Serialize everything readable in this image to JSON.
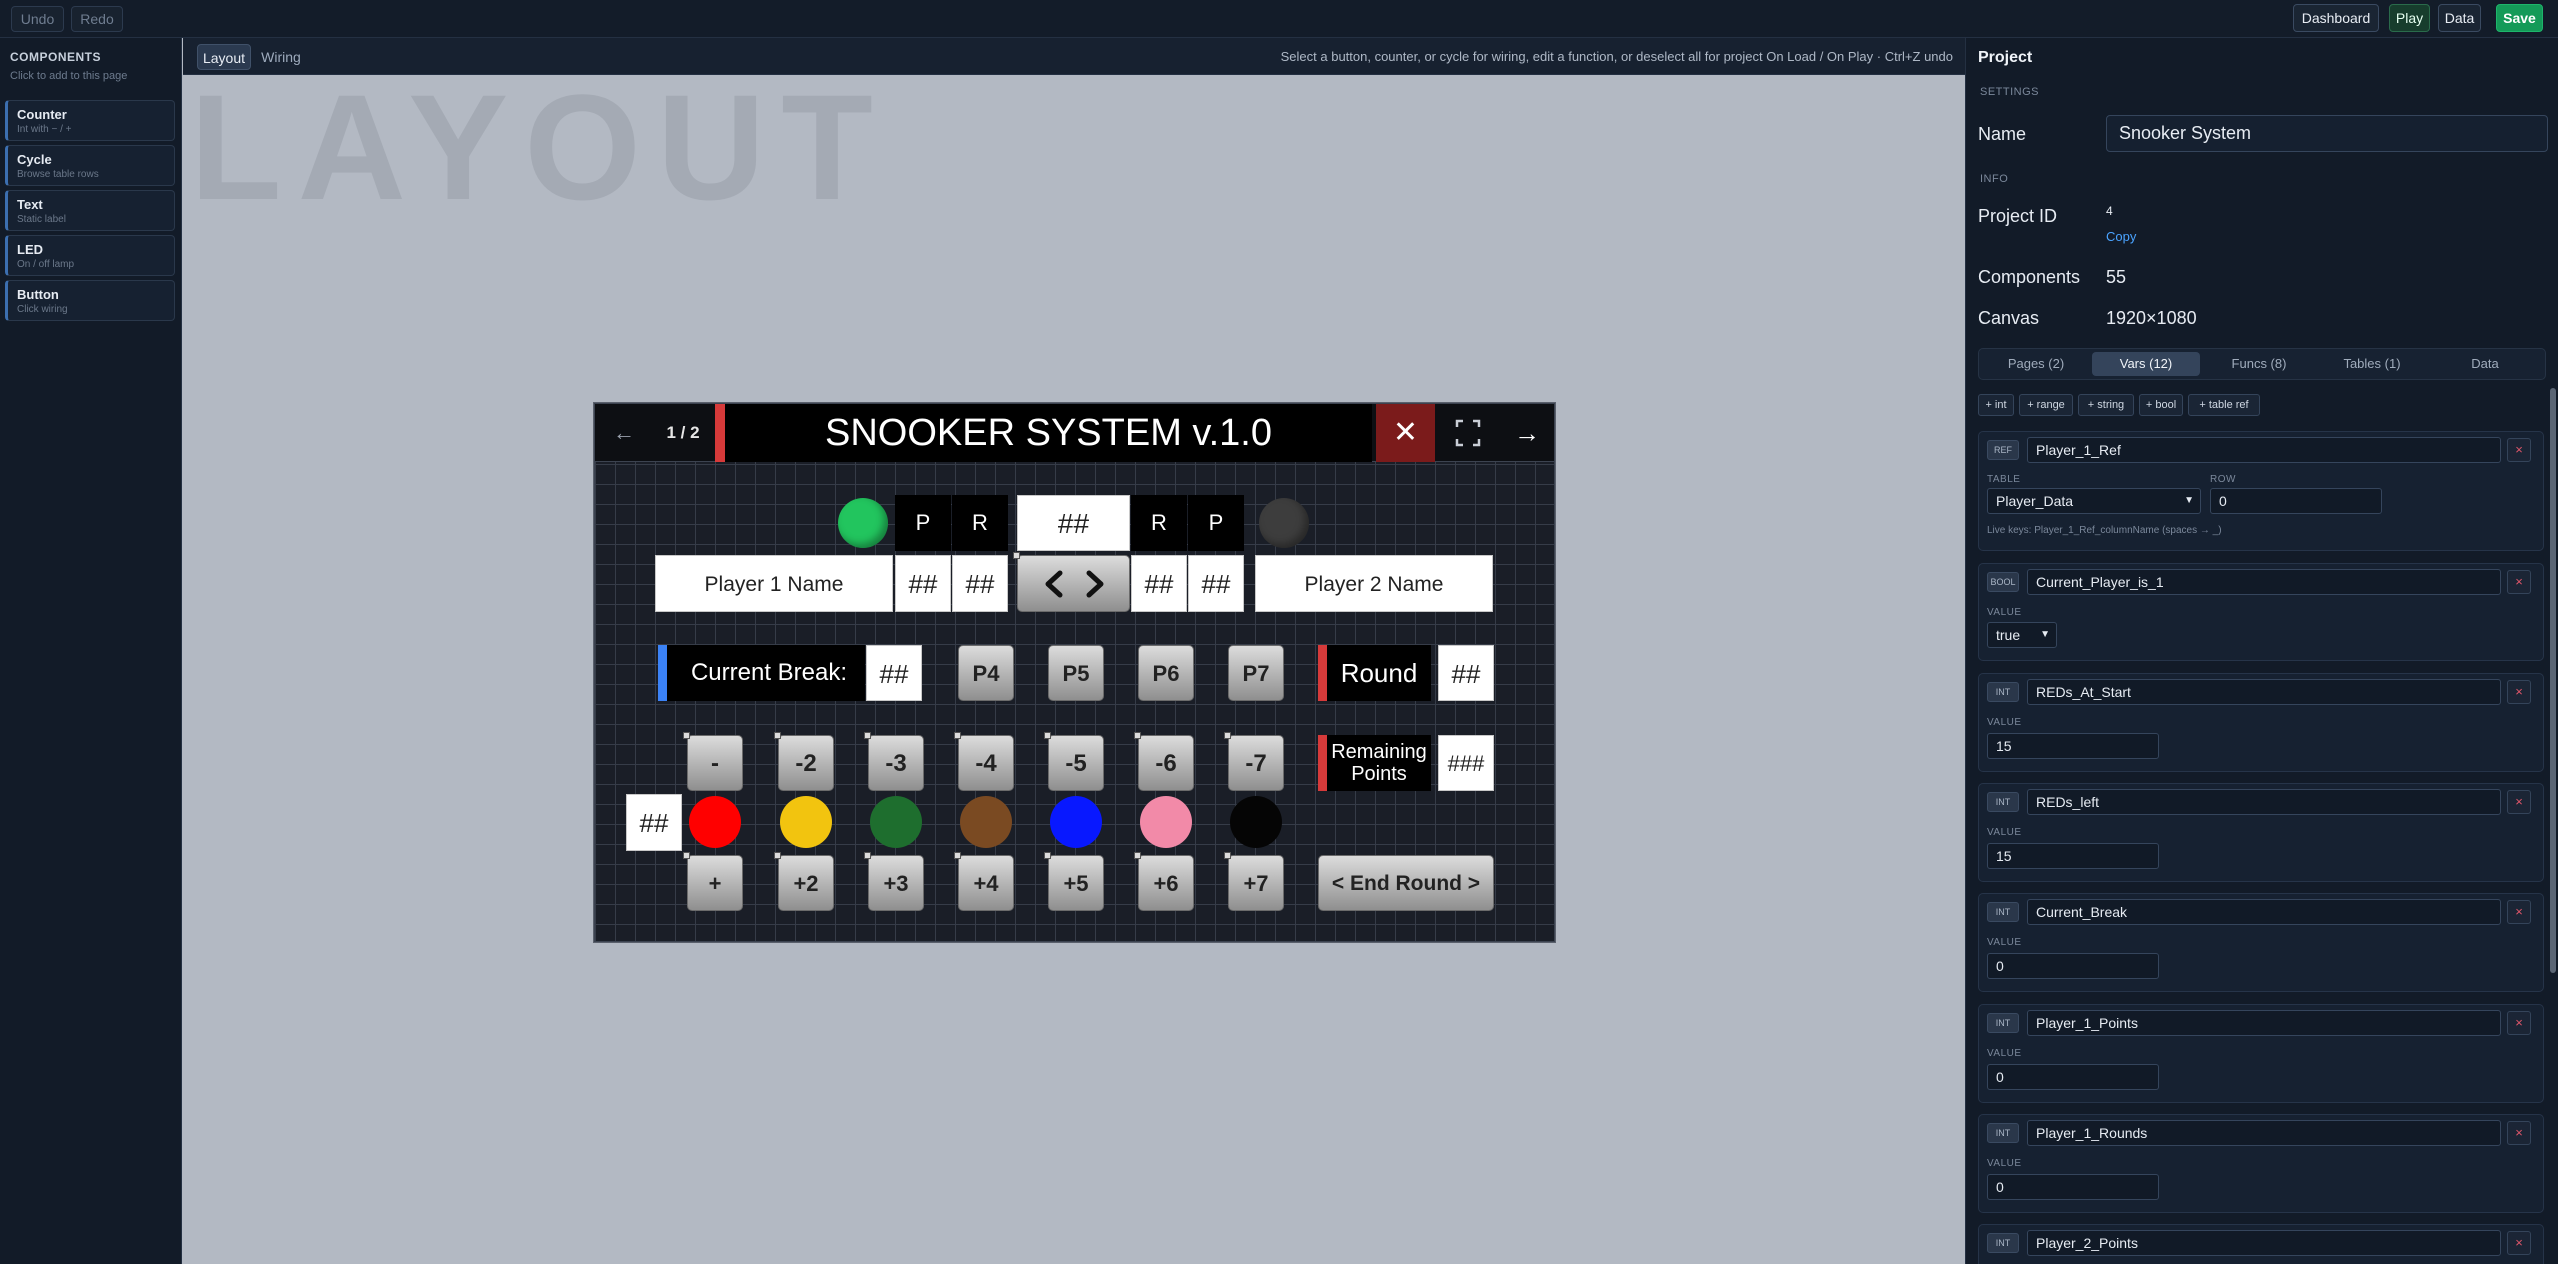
{
  "topbar": {
    "undo": "Undo",
    "redo": "Redo",
    "dashboard": "Dashboard",
    "play": "Play",
    "data": "Data",
    "save": "Save"
  },
  "sidebar": {
    "title": "COMPONENTS",
    "subtitle": "Click to add to this page",
    "items": [
      {
        "name": "Counter",
        "desc": "Int with − / +"
      },
      {
        "name": "Cycle",
        "desc": "Browse table rows"
      },
      {
        "name": "Text",
        "desc": "Static label"
      },
      {
        "name": "LED",
        "desc": "On / off lamp"
      },
      {
        "name": "Button",
        "desc": "Click wiring"
      }
    ]
  },
  "canvas": {
    "tabs": [
      "Layout",
      "Wiring"
    ],
    "hint": "Select a button, counter, or cycle for wiring, edit a function, or deselect all for project On Load / On Play · Ctrl+Z undo",
    "watermark": "LAYOUT"
  },
  "board": {
    "prev": "←",
    "page": "1 / 2",
    "title": "SNOOKER SYSTEM v.1.0",
    "close": "✕",
    "next": "→",
    "p_left": "P",
    "r_left": "R",
    "center_value": "##",
    "r_right": "R",
    "p_right": "P",
    "player1": "Player 1 Name",
    "player2": "Player 2 Name",
    "hash2": "##",
    "hash3": "###",
    "current_break": "Current Break:",
    "round": "Round",
    "remaining": "Remaining Points",
    "p_buttons": [
      "P4",
      "P5",
      "P6",
      "P7"
    ],
    "minus_buttons": [
      "-",
      "-2",
      "-3",
      "-4",
      "-5",
      "-6",
      "-7"
    ],
    "plus_buttons": [
      "+",
      "+2",
      "+3",
      "+4",
      "+5",
      "+6",
      "+7"
    ],
    "end_round": "< End Round >",
    "colors": {
      "red": "#ff0000",
      "yellow": "#f2c40f",
      "green": "#1e6e2e",
      "brown": "#7a4a22",
      "blue": "#0818ff",
      "pink": "#f28aa8",
      "black": "#050505",
      "led_on": "#22c55e",
      "led_off": "#3d3d3d",
      "accent_red": "#d63a3a",
      "accent_blue": "#3b82f6"
    }
  },
  "project": {
    "title": "Project",
    "settings_label": "SETTINGS",
    "name_label": "Name",
    "name_value": "Snooker System",
    "info_label": "INFO",
    "id_label": "Project ID",
    "id_value": "4",
    "copy": "Copy",
    "components_label": "Components",
    "components_value": "55",
    "canvas_label": "Canvas",
    "canvas_value": "1920×1080",
    "tabs": [
      "Pages (2)",
      "Vars (12)",
      "Funcs (8)",
      "Tables (1)",
      "Data"
    ],
    "add_buttons": [
      "+ int",
      "+ range",
      "+ string",
      "+ bool",
      "+ table ref"
    ],
    "ref": {
      "type": "REF",
      "name": "Player_1_Ref",
      "table_label": "TABLE",
      "table_value": "Player_Data",
      "row_label": "ROW",
      "row_value": "0",
      "live_keys": "Live keys: Player_1_Ref_columnName (spaces → _)"
    },
    "bool": {
      "type": "BOOL",
      "name": "Current_Player_is_1",
      "value_label": "VALUE",
      "value": "true"
    },
    "ints": [
      {
        "type": "INT",
        "name": "REDs_At_Start",
        "value_label": "VALUE",
        "value": "15"
      },
      {
        "type": "INT",
        "name": "REDs_left",
        "value_label": "VALUE",
        "value": "15"
      },
      {
        "type": "INT",
        "name": "Current_Break",
        "value_label": "VALUE",
        "value": "0"
      },
      {
        "type": "INT",
        "name": "Player_1_Points",
        "value_label": "VALUE",
        "value": "0"
      },
      {
        "type": "INT",
        "name": "Player_1_Rounds",
        "value_label": "VALUE",
        "value": "0"
      },
      {
        "type": "INT",
        "name": "Player_2_Points"
      }
    ],
    "delete_label": "×"
  }
}
